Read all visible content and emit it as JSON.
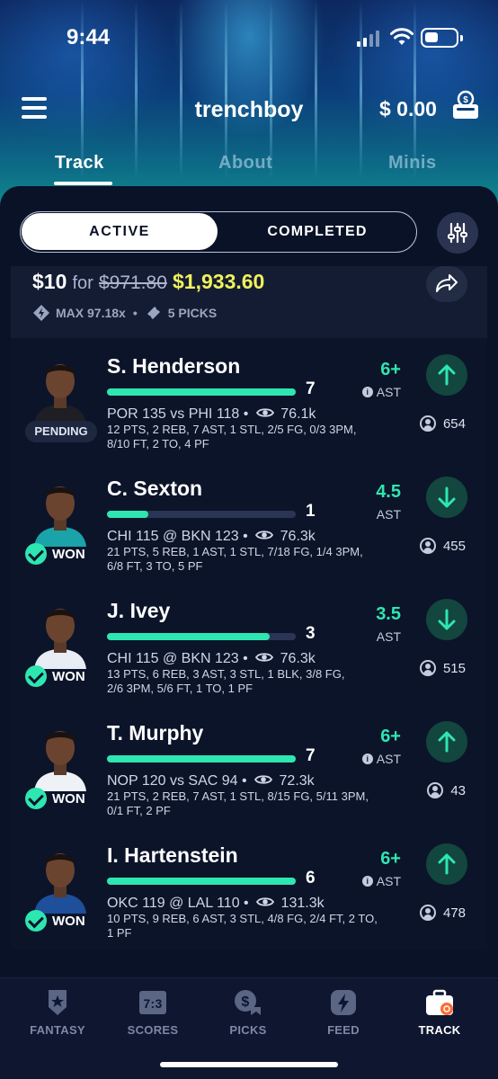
{
  "status_bar": {
    "time": "9:44"
  },
  "header": {
    "username": "trenchboy",
    "balance": "$ 0.00",
    "tabs": [
      {
        "label": "Track",
        "active": true
      },
      {
        "label": "About",
        "active": false
      },
      {
        "label": "Minis",
        "active": false
      }
    ]
  },
  "segment": {
    "active_label": "ACTIVE",
    "inactive_label": "COMPLETED"
  },
  "entry": {
    "stake": "$10",
    "for_word": "for",
    "original_payout": "$971.80",
    "payout": "$1,933.60",
    "max_multiplier": "MAX 97.18x",
    "separator": "•",
    "picks_count": "5 PICKS"
  },
  "picks": [
    {
      "name": "S. Henderson",
      "current": "7",
      "progress_fraction": 1.0,
      "status": "PENDING",
      "game": "POR 135 vs PHI 118 •",
      "views": "76.1k",
      "box_line1": "12 PTS, 2 REB, 7 AST, 1 STL, 2/5 FG, 0/3 3PM,",
      "box_line2": "8/10 FT, 2 TO, 4 PF",
      "line": "6+",
      "stat": "AST",
      "direction": "up",
      "users": "654",
      "jersey_color": "#1e1e24"
    },
    {
      "name": "C. Sexton",
      "current": "1",
      "progress_fraction": 0.22,
      "status": "WON",
      "game": "CHI 115 @ BKN 123 •",
      "views": "76.3k",
      "box_line1": "21 PTS, 5 REB, 1 AST, 1 STL, 7/18 FG, 1/4 3PM,",
      "box_line2": "6/8 FT, 3 TO, 5 PF",
      "line": "4.5",
      "stat": "AST",
      "direction": "down",
      "users": "455",
      "jersey_color": "#1aa3a8"
    },
    {
      "name": "J. Ivey",
      "current": "3",
      "progress_fraction": 0.86,
      "status": "WON",
      "game": "CHI 115 @ BKN 123 •",
      "views": "76.3k",
      "box_line1": "13 PTS, 6 REB, 3 AST, 3 STL, 1 BLK, 3/8 FG,",
      "box_line2": "2/6 3PM, 5/6 FT, 1 TO, 1 PF",
      "line": "3.5",
      "stat": "AST",
      "direction": "down",
      "users": "515",
      "jersey_color": "#e8ecf4"
    },
    {
      "name": "T. Murphy",
      "current": "7",
      "progress_fraction": 1.0,
      "status": "WON",
      "game": "NOP 120 vs SAC 94 •",
      "views": "72.3k",
      "box_line1": "21 PTS, 2 REB, 7 AST, 1 STL, 8/15 FG, 5/11 3PM,",
      "box_line2": "0/1 FT, 2 PF",
      "line": "6+",
      "stat": "AST",
      "direction": "up",
      "users": "43",
      "jersey_color": "#eef1f6"
    },
    {
      "name": "I. Hartenstein",
      "current": "6",
      "progress_fraction": 1.0,
      "status": "WON",
      "game": "OKC 119 @ LAL 110 •",
      "views": "131.3k",
      "box_line1": "10 PTS, 9 REB, 6 AST, 3 STL, 4/8 FG, 2/4 FT, 2 TO,",
      "box_line2": "1 PF",
      "line": "6+",
      "stat": "AST",
      "direction": "up",
      "users": "478",
      "jersey_color": "#1d4f9a"
    }
  ],
  "bottom_nav": [
    {
      "label": "FANTASY",
      "icon": "fantasy-star-icon",
      "active": false
    },
    {
      "label": "SCORES",
      "icon": "scores-7-3-icon",
      "icon_text": "7:3",
      "active": false
    },
    {
      "label": "PICKS",
      "icon": "picks-dollar-icon",
      "active": false
    },
    {
      "label": "FEED",
      "icon": "feed-lightning-icon",
      "active": false
    },
    {
      "label": "TRACK",
      "icon": "track-briefcase-icon",
      "active": true
    }
  ],
  "colors": {
    "accent": "#2ee6b0",
    "payout": "#f0f25a",
    "panel": "#0a1227",
    "up_bg": "#12463f"
  }
}
